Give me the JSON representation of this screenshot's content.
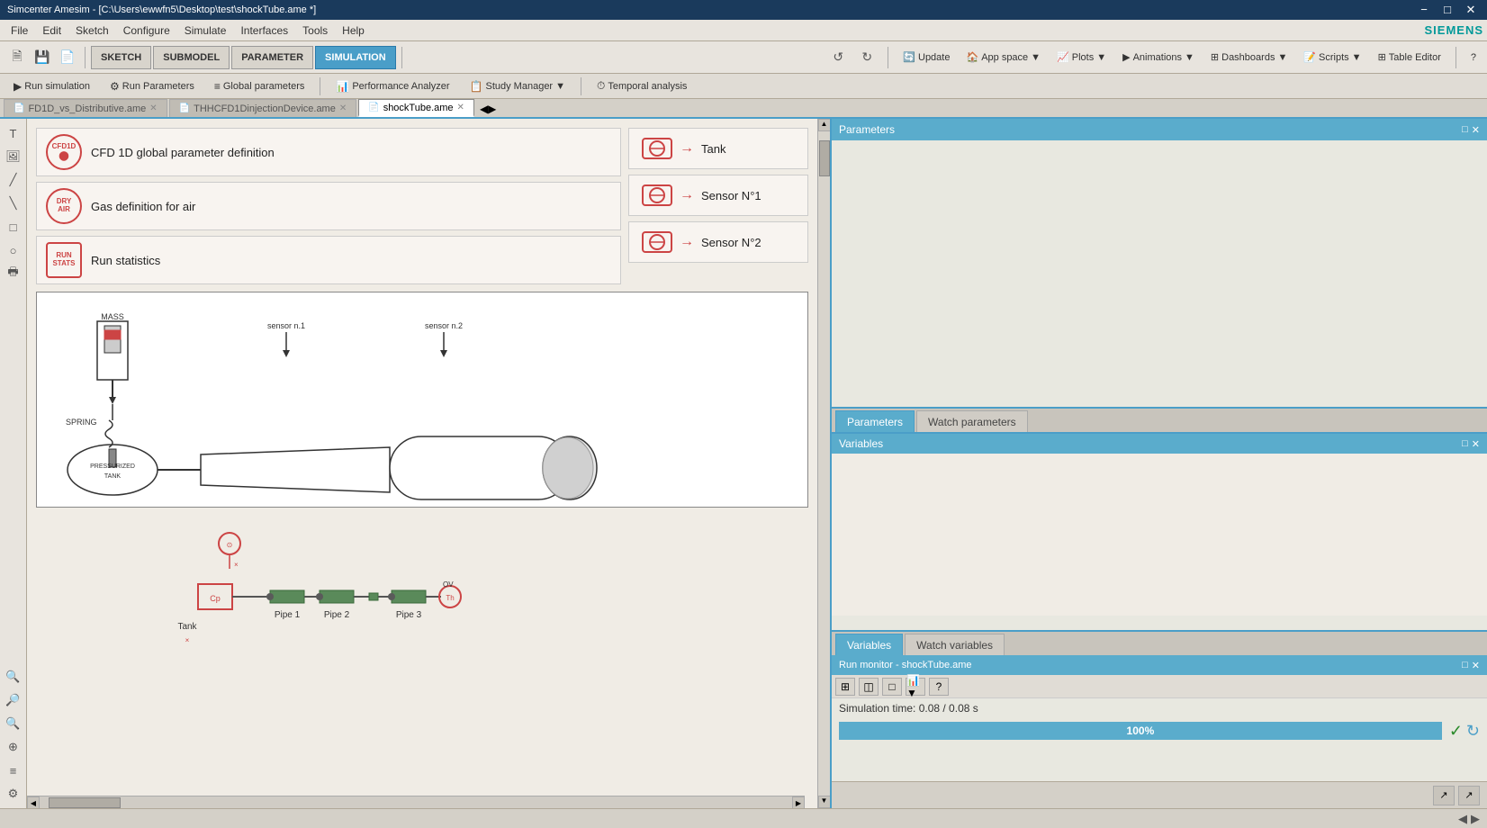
{
  "title_bar": {
    "title": "Simcenter Amesim - [C:\\Users\\ewwfn5\\Desktop\\test\\shockTube.ame *]",
    "controls": [
      "−",
      "□",
      "×"
    ]
  },
  "menu": {
    "items": [
      "File",
      "Edit",
      "Sketch",
      "Configure",
      "Simulate",
      "Interfaces",
      "Tools",
      "Help"
    ]
  },
  "toolbar": {
    "mode_buttons": [
      "SKETCH",
      "SUBMODEL",
      "PARAMETER",
      "SIMULATION"
    ],
    "active_mode": "SIMULATION",
    "undo_label": "↺",
    "redo_label": "↻",
    "update_label": "Update",
    "app_space_label": "App space",
    "plots_label": "Plots",
    "animations_label": "Animations",
    "dashboards_label": "Dashboards",
    "scripts_label": "Scripts",
    "table_editor_label": "Table Editor",
    "help_label": "?"
  },
  "action_bar": {
    "run_sim_label": "Run simulation",
    "run_params_label": "Run Parameters",
    "global_params_label": "Global parameters",
    "perf_analyzer_label": "Performance Analyzer",
    "study_manager_label": "Study Manager",
    "temporal_label": "Temporal analysis"
  },
  "tabs": [
    {
      "label": "FD1D_vs_Distributive.ame",
      "active": false,
      "modified": true
    },
    {
      "label": "THHCFD1DinjectionDevice.ame",
      "active": false,
      "modified": true
    },
    {
      "label": "shockTube.ame",
      "active": true,
      "modified": true
    }
  ],
  "components": [
    {
      "icon_text": "CFD1D",
      "icon_sub": "⬤",
      "label": "CFD 1D global parameter definition",
      "type": "circle"
    },
    {
      "icon_text": "DRY\nAIR",
      "label": "Gas definition for air",
      "type": "circle"
    },
    {
      "icon_text": "RUN\nSTATS",
      "label": "Run statistics",
      "type": "box"
    }
  ],
  "sensors": [
    {
      "label": "Tank"
    },
    {
      "label": "Sensor N°1"
    },
    {
      "label": "Sensor N°2"
    }
  ],
  "shock_tube": {
    "mass_label": "MASS",
    "spring_label": "SPRING",
    "pressurized_label": "PRESSURIZED\nTANK",
    "sensor1_label": "sensor n.1",
    "sensor2_label": "sensor n.2"
  },
  "schematic": {
    "tank_label": "Tank",
    "pipe1_label": "Pipe 1",
    "pipe2_label": "Pipe 2",
    "pipe3_label": "Pipe 3"
  },
  "right_panel": {
    "title": "Parameters",
    "tabs": {
      "params_label": "Parameters",
      "watch_params_label": "Watch parameters"
    },
    "variables_title": "Variables",
    "bottom_tabs": {
      "variables_label": "Variables",
      "watch_vars_label": "Watch variables"
    },
    "run_monitor_title": "Run monitor - shockTube.ame",
    "sim_time_label": "Simulation time: 0.08 / 0.08 s",
    "progress_value": "100%"
  },
  "status_bar": {
    "text": ""
  }
}
